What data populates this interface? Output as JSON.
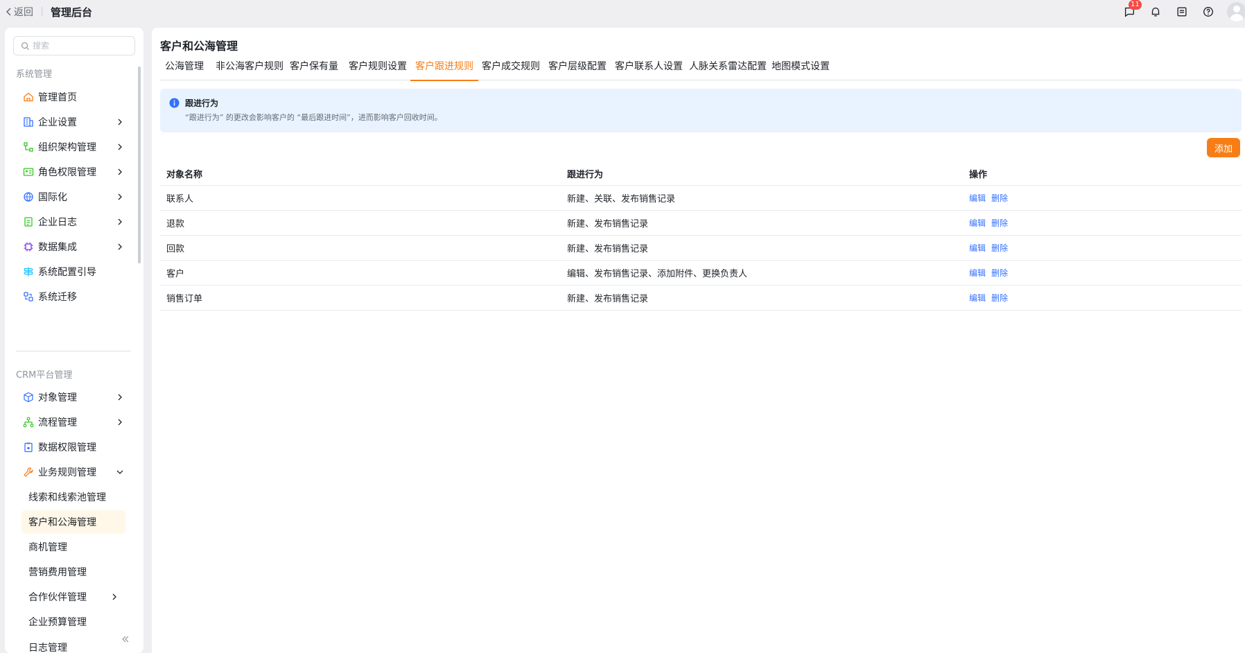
{
  "topbar": {
    "back_label": "返回",
    "title": "管理后台",
    "message_badge": "11"
  },
  "sidebar": {
    "search_placeholder": "搜索",
    "group1_title": "系统管理",
    "group1_items": [
      {
        "label": "管理首页",
        "icon": "home-icon"
      },
      {
        "label": "企业设置",
        "icon": "building-icon"
      },
      {
        "label": "组织架构管理",
        "icon": "org-tree-icon"
      },
      {
        "label": "角色权限管理",
        "icon": "id-card-icon"
      },
      {
        "label": "国际化",
        "icon": "globe-icon"
      },
      {
        "label": "企业日志",
        "icon": "log-icon"
      },
      {
        "label": "数据集成",
        "icon": "chip-icon"
      },
      {
        "label": "系统配置引导",
        "icon": "signpost-icon"
      },
      {
        "label": "系统迁移",
        "icon": "migrate-icon"
      }
    ],
    "group2_title": "CRM平台管理",
    "group2_items": [
      {
        "label": "对象管理",
        "icon": "cube-icon"
      },
      {
        "label": "流程管理",
        "icon": "flow-icon"
      },
      {
        "label": "数据权限管理",
        "icon": "clipboard-lock-icon"
      },
      {
        "label": "业务规则管理",
        "icon": "wrench-icon"
      }
    ],
    "sub_items": [
      {
        "label": "线索和线索池管理"
      },
      {
        "label": "客户和公海管理"
      },
      {
        "label": "商机管理"
      },
      {
        "label": "营销费用管理"
      },
      {
        "label": "合作伙伴管理"
      },
      {
        "label": "企业预算管理"
      },
      {
        "label": "日志管理"
      }
    ]
  },
  "main": {
    "page_title": "客户和公海管理",
    "tabs": [
      {
        "label": "公海管理"
      },
      {
        "label": "非公海客户规则"
      },
      {
        "label": "客户保有量"
      },
      {
        "label": "客户规则设置"
      },
      {
        "label": "客户跟进规则"
      },
      {
        "label": "客户成交规则"
      },
      {
        "label": "客户层级配置"
      },
      {
        "label": "客户联系人设置"
      },
      {
        "label": "人脉关系雷达配置"
      },
      {
        "label": "地图模式设置"
      }
    ],
    "active_tab": "客户跟进规则",
    "alert": {
      "title": "跟进行为",
      "desc": "“跟进行为” 的更改会影响客户的 “最后跟进时间”，进而影响客户回收时间。"
    },
    "add_button": "添加",
    "table": {
      "headers": [
        "对象名称",
        "跟进行为",
        "操作"
      ],
      "rows": [
        {
          "name": "联系人",
          "behavior": "新建、关联、发布销售记录"
        },
        {
          "name": "退款",
          "behavior": "新建、发布销售记录"
        },
        {
          "name": "回款",
          "behavior": "新建、发布销售记录"
        },
        {
          "name": "客户",
          "behavior": "编辑、发布销售记录、添加附件、更换负责人"
        },
        {
          "name": "销售订单",
          "behavior": "新建、发布销售记录"
        }
      ],
      "edit_label": "编辑",
      "delete_label": "删除"
    }
  },
  "colors": {
    "accent": "#f77e17",
    "link": "#3370ff",
    "alert_bg": "#e8f3ff",
    "active_nav_bg": "#fff7e8"
  }
}
